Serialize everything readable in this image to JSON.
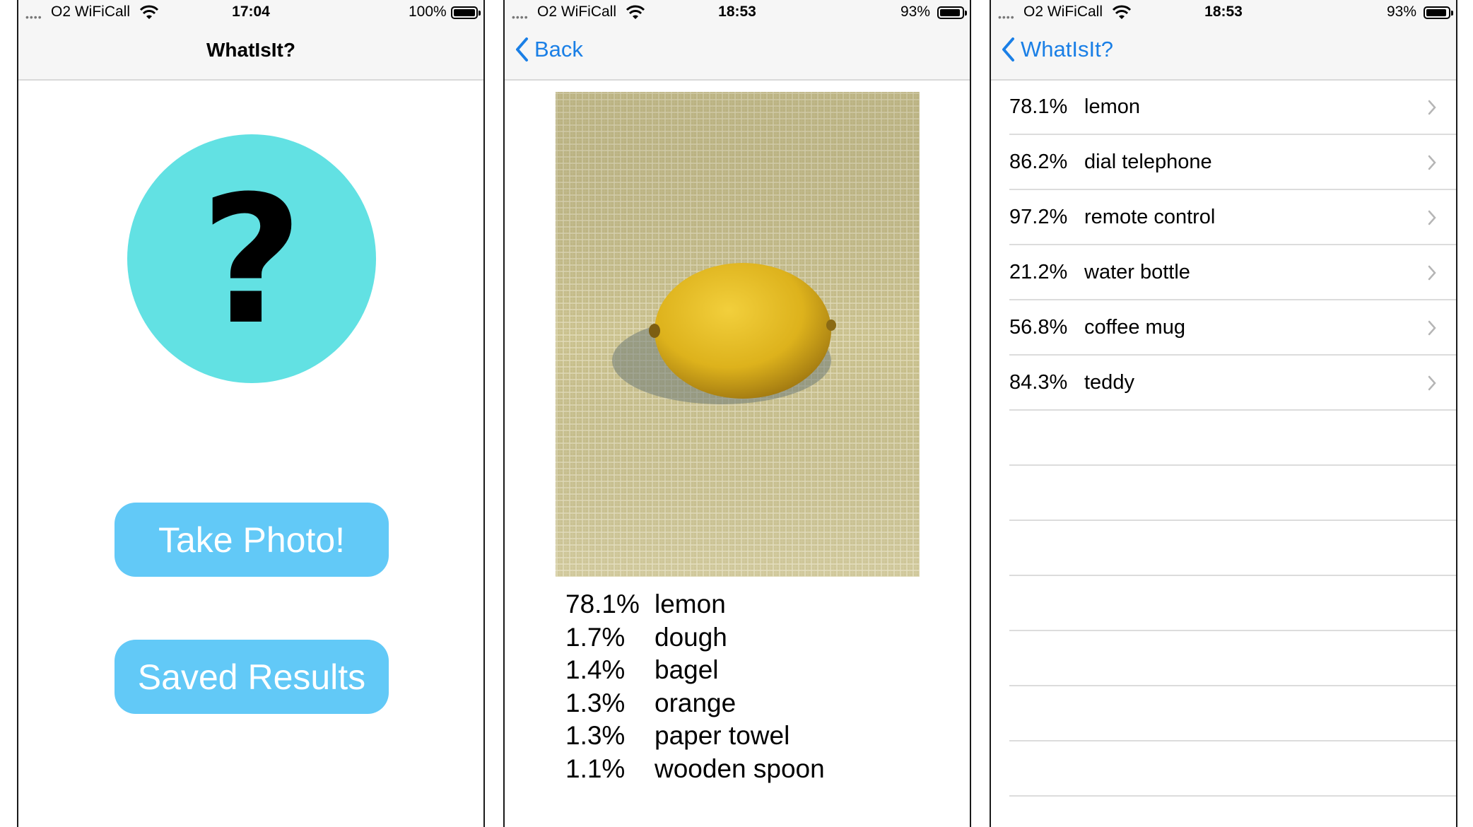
{
  "screen1": {
    "status": {
      "carrier": "O2 WiFiCall",
      "time": "17:04",
      "battery": "100%",
      "battery_level": 1.0
    },
    "nav_title": "WhatIsIt?",
    "question_mark": "?",
    "take_photo_label": "Take Photo!",
    "saved_results_label": "Saved Results",
    "colors": {
      "circle": "#62e1e3",
      "button": "#62c9f7"
    }
  },
  "screen2": {
    "status": {
      "carrier": "O2 WiFiCall",
      "time": "18:53",
      "battery": "93%",
      "battery_level": 0.93
    },
    "back_label": "Back",
    "photo_subject": "lemon",
    "results": [
      {
        "pct": "78.1%",
        "label": "lemon"
      },
      {
        "pct": "1.7%",
        "label": "dough"
      },
      {
        "pct": "1.4%",
        "label": "bagel"
      },
      {
        "pct": "1.3%",
        "label": "orange"
      },
      {
        "pct": "1.3%",
        "label": "paper towel"
      },
      {
        "pct": "1.1%",
        "label": "wooden spoon"
      }
    ]
  },
  "screen3": {
    "status": {
      "carrier": "O2 WiFiCall",
      "time": "18:53",
      "battery": "93%",
      "battery_level": 0.93
    },
    "back_label": "WhatIsIt?",
    "saved": [
      {
        "pct": "78.1%",
        "label": "lemon"
      },
      {
        "pct": "86.2%",
        "label": "dial telephone"
      },
      {
        "pct": "97.2%",
        "label": "remote control"
      },
      {
        "pct": "21.2%",
        "label": "water bottle"
      },
      {
        "pct": "56.8%",
        "label": "coffee mug"
      },
      {
        "pct": "84.3%",
        "label": "teddy"
      }
    ]
  },
  "accent_color": "#1a7fe6"
}
